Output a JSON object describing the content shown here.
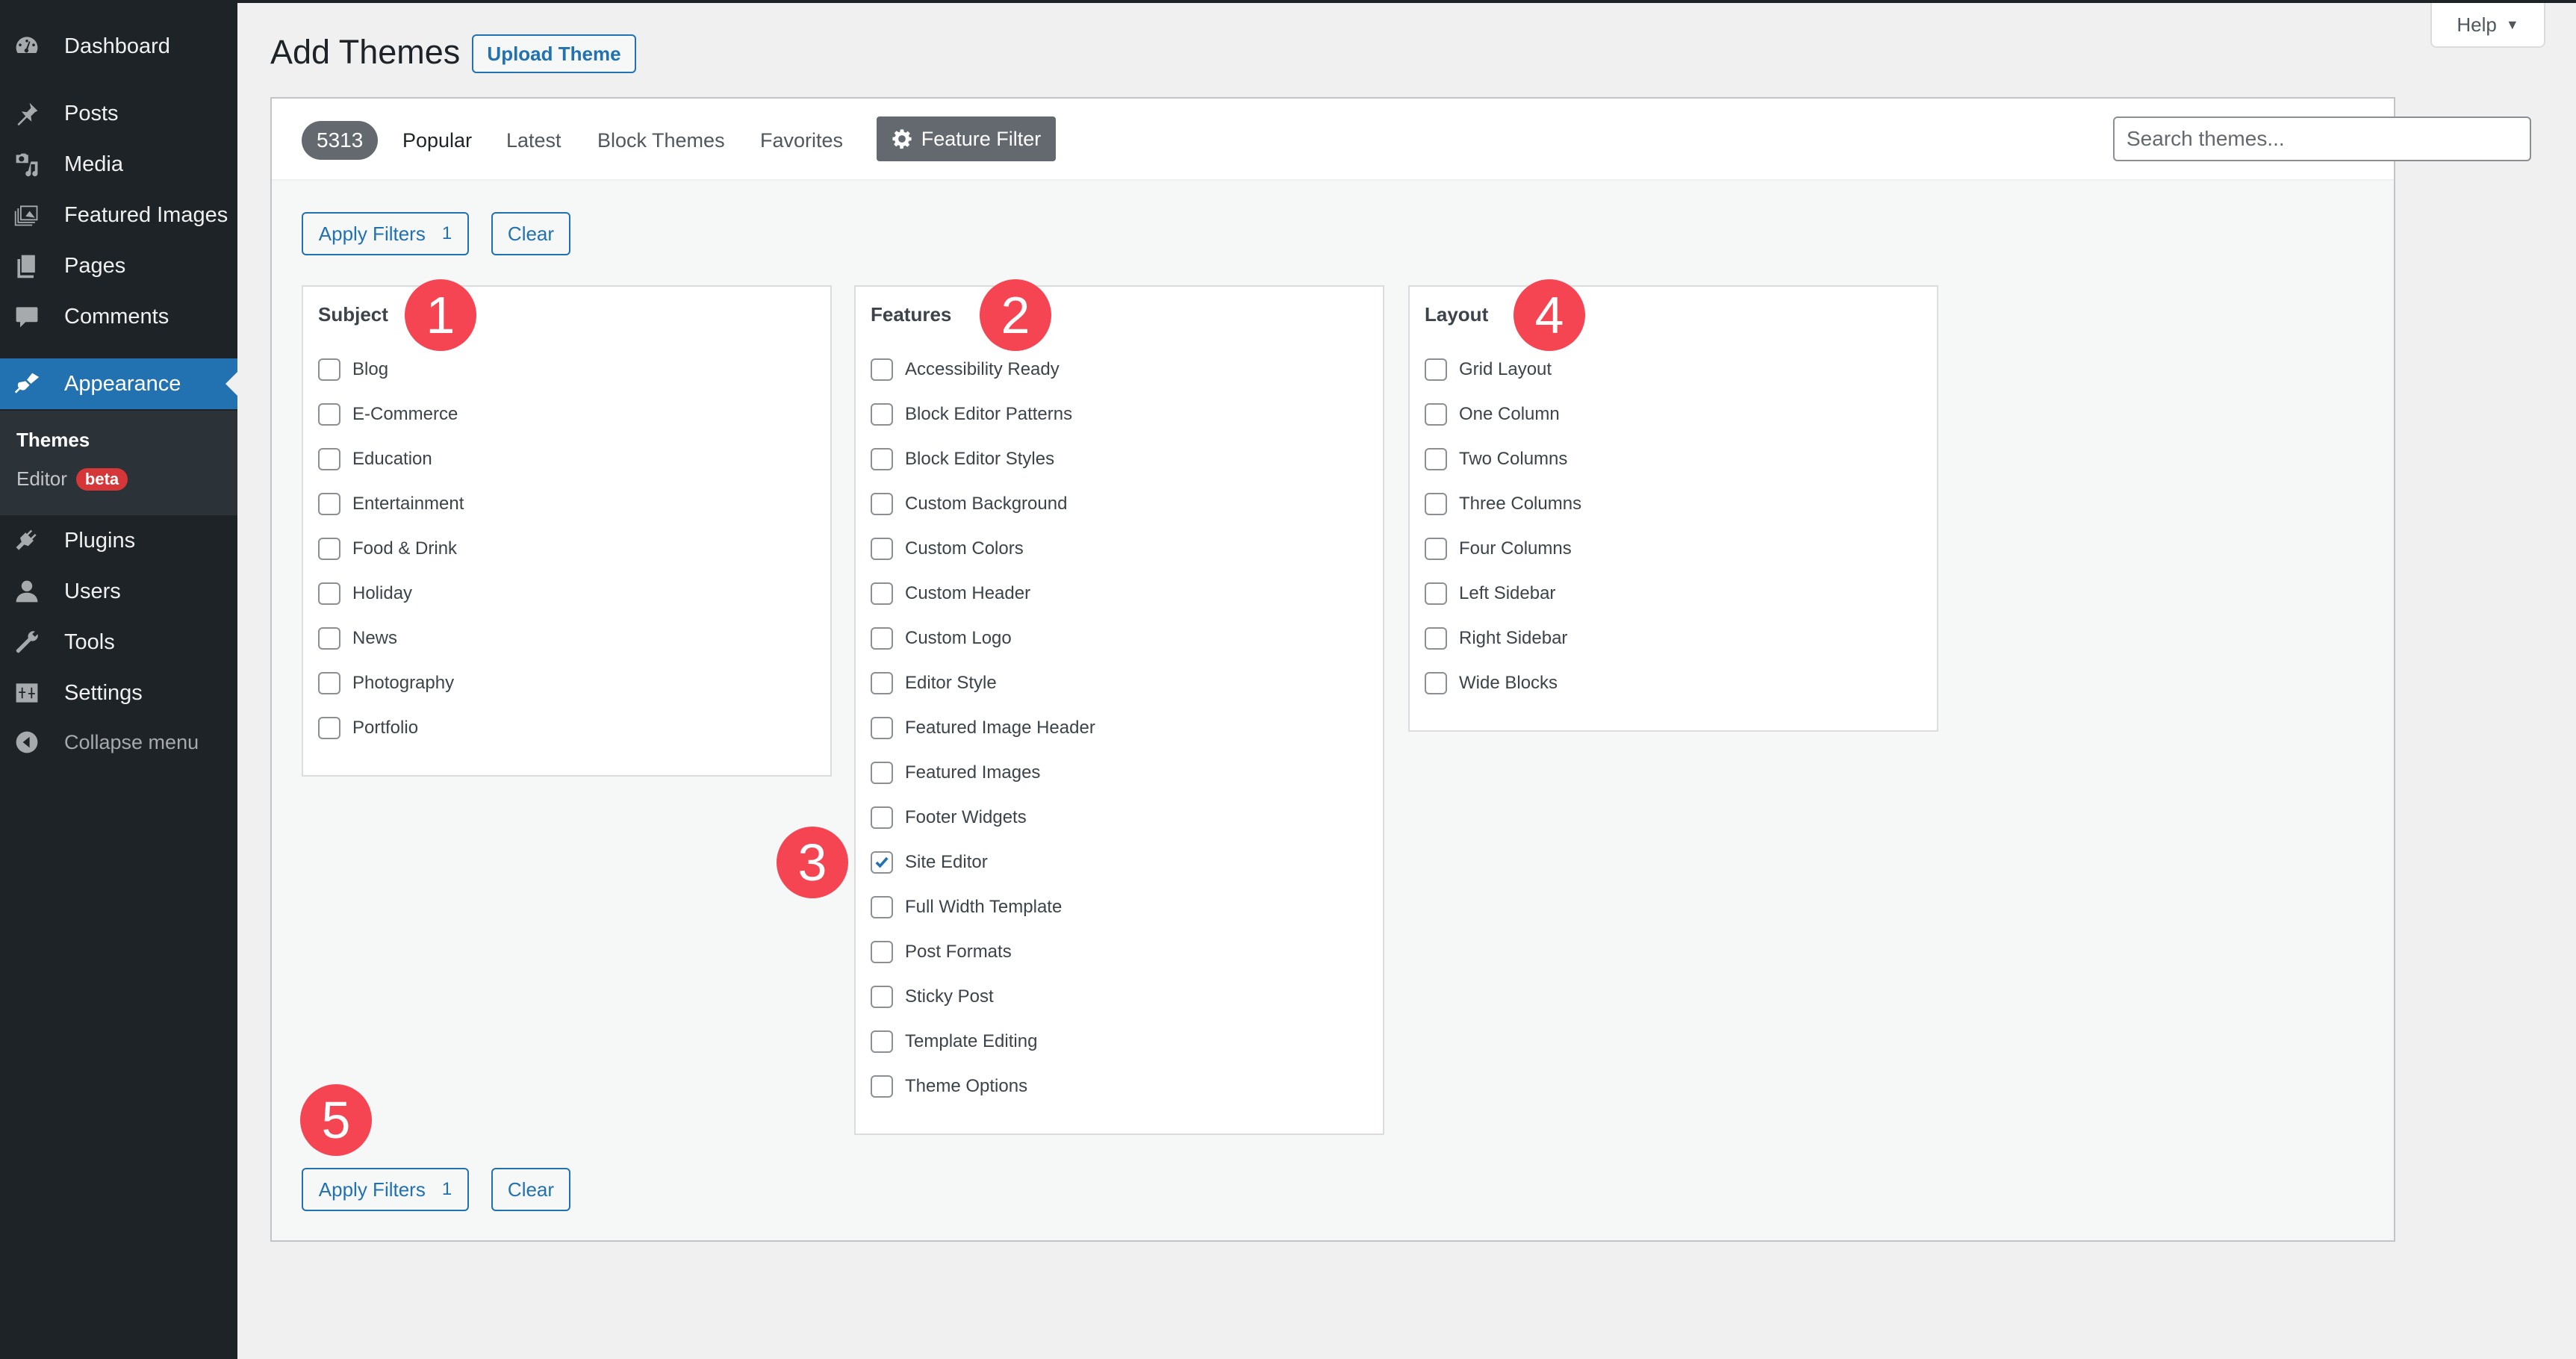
{
  "sidebar": {
    "items": [
      {
        "label": "Dashboard",
        "icon": "dashboard-icon"
      },
      {
        "label": "Posts",
        "icon": "pin-icon"
      },
      {
        "label": "Media",
        "icon": "media-icon"
      },
      {
        "label": "Featured Images",
        "icon": "images-icon"
      },
      {
        "label": "Pages",
        "icon": "pages-icon"
      },
      {
        "label": "Comments",
        "icon": "comment-icon"
      },
      {
        "label": "Appearance",
        "icon": "paintbrush-icon",
        "active": true
      },
      {
        "label": "Plugins",
        "icon": "plugin-icon"
      },
      {
        "label": "Users",
        "icon": "user-icon"
      },
      {
        "label": "Tools",
        "icon": "wrench-icon"
      },
      {
        "label": "Settings",
        "icon": "settings-icon"
      }
    ],
    "submenu": {
      "themes": "Themes",
      "editor": "Editor",
      "editor_badge": "beta"
    },
    "collapse": "Collapse menu"
  },
  "header": {
    "title": "Add Themes",
    "upload_button": "Upload Theme",
    "help": "Help"
  },
  "filter_bar": {
    "count": "5313",
    "tabs": [
      "Popular",
      "Latest",
      "Block Themes",
      "Favorites"
    ],
    "active_tab": "Popular",
    "feature_filter": "Feature Filter",
    "search_placeholder": "Search themes..."
  },
  "actions": {
    "apply": "Apply Filters",
    "apply_count": "1",
    "clear": "Clear"
  },
  "groups": {
    "subject": {
      "title": "Subject",
      "options": [
        {
          "label": "Blog",
          "checked": false
        },
        {
          "label": "E-Commerce",
          "checked": false
        },
        {
          "label": "Education",
          "checked": false
        },
        {
          "label": "Entertainment",
          "checked": false
        },
        {
          "label": "Food & Drink",
          "checked": false
        },
        {
          "label": "Holiday",
          "checked": false
        },
        {
          "label": "News",
          "checked": false
        },
        {
          "label": "Photography",
          "checked": false
        },
        {
          "label": "Portfolio",
          "checked": false
        }
      ]
    },
    "features": {
      "title": "Features",
      "options": [
        {
          "label": "Accessibility Ready",
          "checked": false
        },
        {
          "label": "Block Editor Patterns",
          "checked": false
        },
        {
          "label": "Block Editor Styles",
          "checked": false
        },
        {
          "label": "Custom Background",
          "checked": false
        },
        {
          "label": "Custom Colors",
          "checked": false
        },
        {
          "label": "Custom Header",
          "checked": false
        },
        {
          "label": "Custom Logo",
          "checked": false
        },
        {
          "label": "Editor Style",
          "checked": false
        },
        {
          "label": "Featured Image Header",
          "checked": false
        },
        {
          "label": "Featured Images",
          "checked": false
        },
        {
          "label": "Footer Widgets",
          "checked": false
        },
        {
          "label": "Site Editor",
          "checked": true
        },
        {
          "label": "Full Width Template",
          "checked": false
        },
        {
          "label": "Post Formats",
          "checked": false
        },
        {
          "label": "Sticky Post",
          "checked": false
        },
        {
          "label": "Template Editing",
          "checked": false
        },
        {
          "label": "Theme Options",
          "checked": false
        }
      ]
    },
    "layout": {
      "title": "Layout",
      "options": [
        {
          "label": "Grid Layout",
          "checked": false
        },
        {
          "label": "One Column",
          "checked": false
        },
        {
          "label": "Two Columns",
          "checked": false
        },
        {
          "label": "Three Columns",
          "checked": false
        },
        {
          "label": "Four Columns",
          "checked": false
        },
        {
          "label": "Left Sidebar",
          "checked": false
        },
        {
          "label": "Right Sidebar",
          "checked": false
        },
        {
          "label": "Wide Blocks",
          "checked": false
        }
      ]
    }
  },
  "annotations": [
    "1",
    "2",
    "3",
    "4",
    "5"
  ],
  "colors": {
    "accent": "#2271b1",
    "badge": "#f54452",
    "sidebar": "#1d2327"
  }
}
